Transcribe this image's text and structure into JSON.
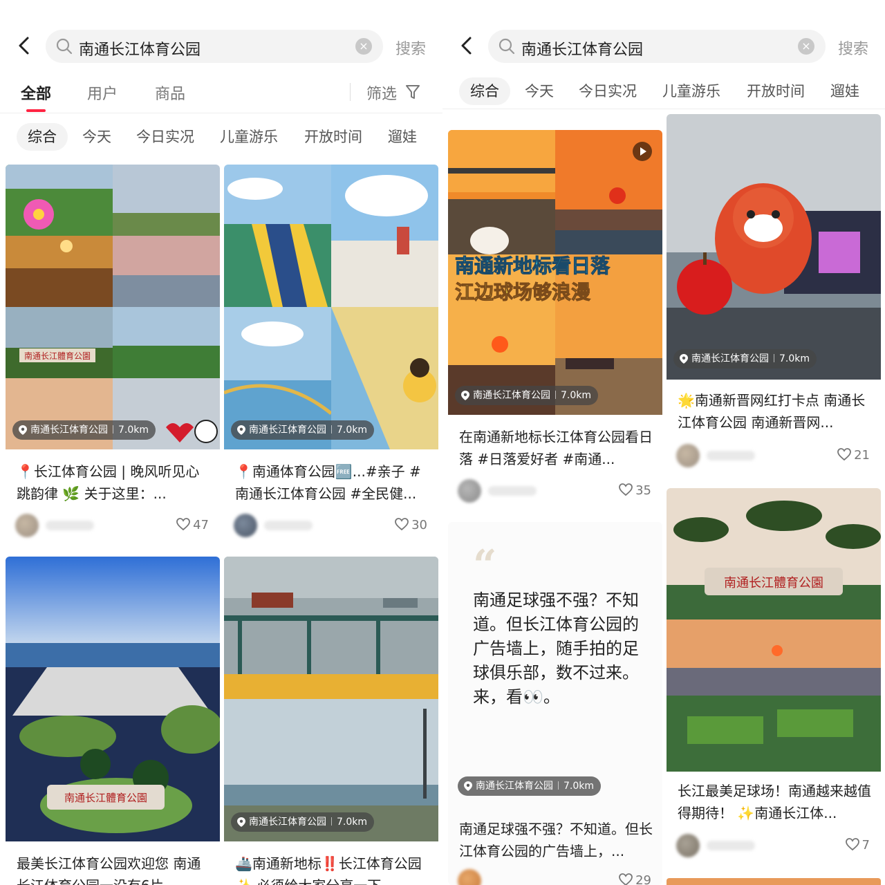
{
  "search": {
    "query": "南通长江体育公园",
    "clear_icon": "×",
    "button_label": "搜索"
  },
  "top_tabs": {
    "all": "全部",
    "users": "用户",
    "products": "商品",
    "filter": "筛选"
  },
  "chips": [
    "综合",
    "今天",
    "今日实况",
    "儿童游乐",
    "开放时间",
    "遛娃"
  ],
  "location": {
    "name": "南通长江体育公园",
    "distance": "7.0km"
  },
  "colors": {
    "accent": "#ff2442",
    "chip_bg": "#f3f3f3"
  },
  "left_cards": [
    {
      "title": "📍长江体育公园 | 晚风听见心跳韵律 🌿 关于这里：...",
      "likes": "47"
    },
    {
      "title": "📍南通体育公园🆓...#亲子 #南通长江体育公园 #全民健...",
      "likes": "30"
    },
    {
      "title": "最美长江体育公园欢迎您 南通长江体育公园一没有6片",
      "likes": ""
    },
    {
      "title": "🚢南通新地标‼️长江体育公园✨ 必须给大家分享一下",
      "likes": ""
    }
  ],
  "right_cards": [
    {
      "title": "在南通新地标长江体育公园看日落 #日落爱好者 #南通...",
      "likes": "35",
      "overlay_line1": "南通新地标看日落",
      "overlay_line2": "江边球场够浪漫"
    },
    {
      "title": "🌟南通新晋网红打卡点 南通长江体育公园 南通新晋网...",
      "likes": "21"
    },
    {
      "quote": "南通足球强不强？不知道。但长江体育公园的广告墙上，随手拍的足球俱乐部，数不过来。来，看👀。",
      "quote_mark": "“",
      "title": "南通足球强不强？不知道。但长江体育公园的广告墙上，...",
      "likes": "29"
    },
    {
      "title": "长江最美足球场！南通越来越值得期待！ ✨南通长江体...",
      "likes": "7"
    }
  ],
  "sign_text": "南通长江體育公園"
}
